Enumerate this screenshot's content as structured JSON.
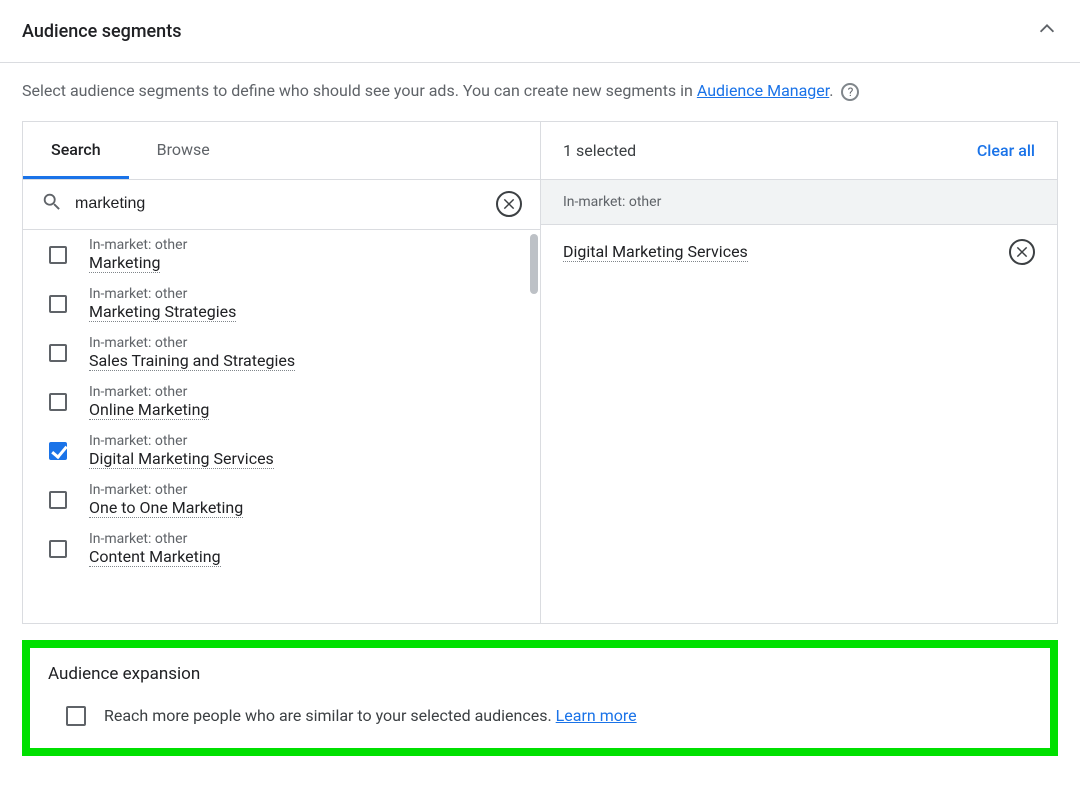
{
  "header": {
    "title": "Audience segments"
  },
  "description": {
    "pre": "Select audience segments to define who should see your ads. You can create new segments in ",
    "link": "Audience Manager",
    "post": "."
  },
  "tabs": {
    "search": "Search",
    "browse": "Browse",
    "active": "search"
  },
  "search": {
    "value": "marketing"
  },
  "results": [
    {
      "category": "In-market: other",
      "name": "Marketing",
      "checked": false
    },
    {
      "category": "In-market: other",
      "name": "Marketing Strategies",
      "checked": false
    },
    {
      "category": "In-market: other",
      "name": "Sales Training and Strategies",
      "checked": false
    },
    {
      "category": "In-market: other",
      "name": "Online Marketing",
      "checked": false
    },
    {
      "category": "In-market: other",
      "name": "Digital Marketing Services",
      "checked": true
    },
    {
      "category": "In-market: other",
      "name": "One to One Marketing",
      "checked": false
    },
    {
      "category": "In-market: other",
      "name": "Content Marketing",
      "checked": false
    }
  ],
  "selected": {
    "count_label": "1 selected",
    "clear_all": "Clear all",
    "group_label": "In-market: other",
    "items": [
      {
        "name": "Digital Marketing Services"
      }
    ]
  },
  "expansion": {
    "title": "Audience expansion",
    "checked": false,
    "text": "Reach more people who are similar to your selected audiences. ",
    "link": "Learn more"
  }
}
